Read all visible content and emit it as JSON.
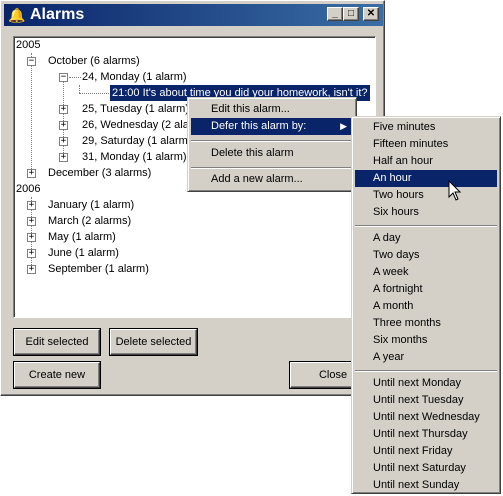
{
  "window": {
    "title": "Alarms",
    "icon": "bell-icon",
    "controls": {
      "minimize": "_",
      "maximize": "□",
      "close": "✕"
    }
  },
  "tree": {
    "year_2005": "2005",
    "october": "October  (6 alarms)",
    "oct24": "24, Monday  (1 alarm)",
    "oct24_alarm": "21:00  It's about time you did your homework, isn't it?",
    "oct25": "25, Tuesday  (1 alarm)",
    "oct26": "26, Wednesday  (2 ala",
    "oct29": "29, Saturday  (1 alarm)",
    "oct31": "31, Monday  (1 alarm)",
    "december": "December  (3 alarms)",
    "year_2006": "2006",
    "january": "January  (1 alarm)",
    "march": "March  (2 alarms)",
    "may": "May  (1 alarm)",
    "june": "June  (1 alarm)",
    "september": "September  (1 alarm)"
  },
  "buttons": {
    "edit_selected": "Edit selected",
    "delete_selected": "Delete selected",
    "create_new": "Create new",
    "close": "Close"
  },
  "context_menu": {
    "edit": "Edit this alarm...",
    "defer": "Defer this alarm by:",
    "delete": "Delete this alarm",
    "add": "Add a new alarm..."
  },
  "defer_menu": {
    "group1": [
      "Five minutes",
      "Fifteen minutes",
      "Half an hour",
      "An hour",
      "Two hours",
      "Six hours"
    ],
    "group2": [
      "A day",
      "Two days",
      "A week",
      "A fortnight",
      "A month",
      "Three months",
      "Six months",
      "A year"
    ],
    "group3": [
      "Until next Monday",
      "Until next Tuesday",
      "Until next Wednesday",
      "Until next Thursday",
      "Until next Friday",
      "Until next Saturday",
      "Until next Sunday"
    ],
    "highlighted": "An hour"
  }
}
